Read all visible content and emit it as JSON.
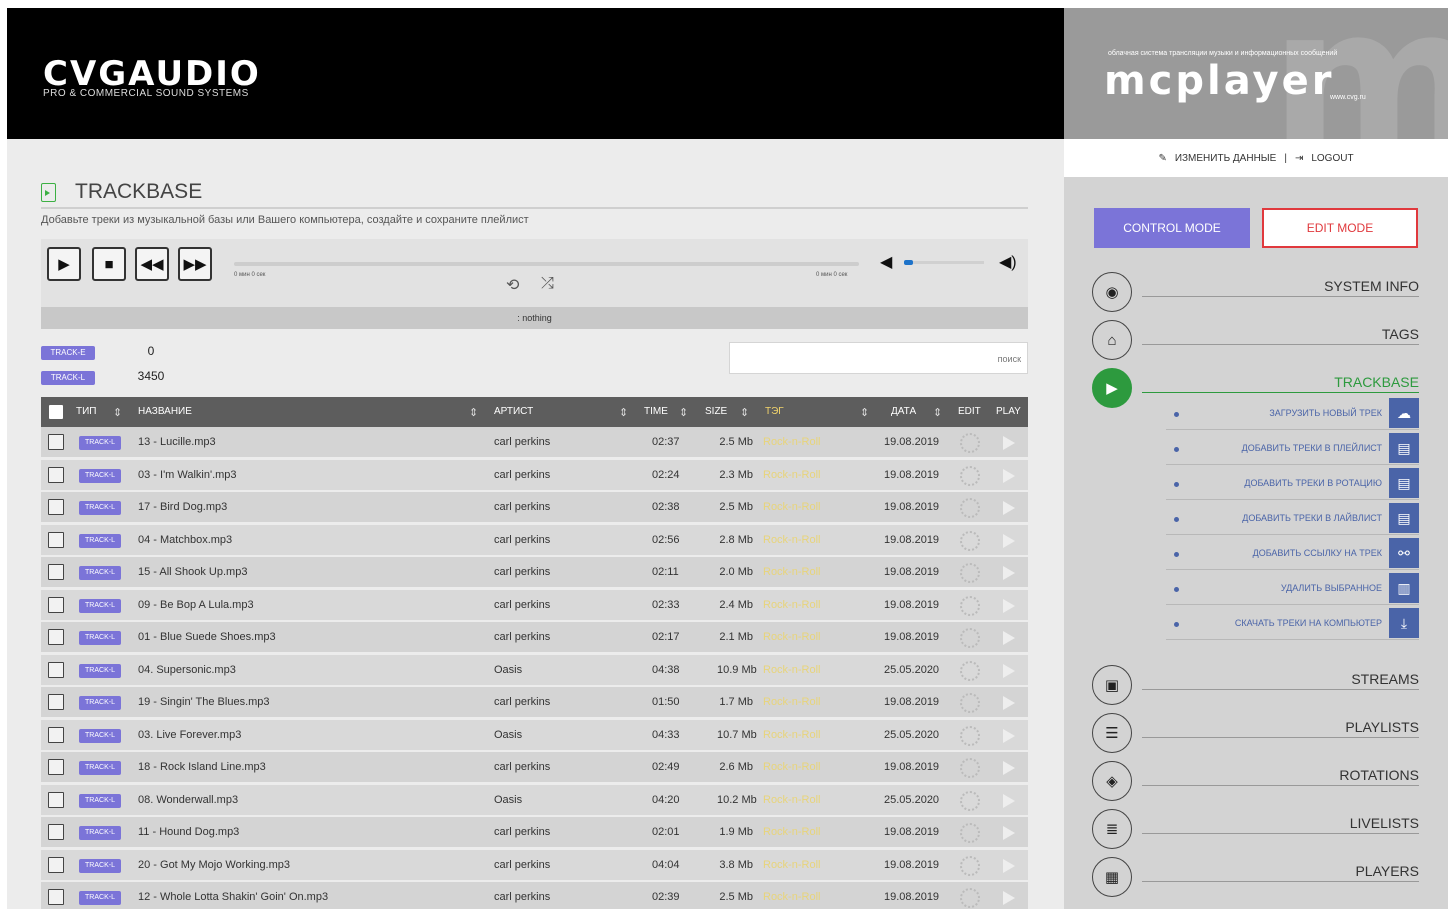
{
  "header": {
    "brand_left": "CVGAUDIO",
    "brand_left_sub": "PRO & COMMERCIAL SOUND SYSTEMS",
    "brand_right": "mcplayer",
    "brand_right_tag": "облачная система трансляции музыки и информационных сообщений",
    "brand_right_url": "www.cvg.ru"
  },
  "page": {
    "title": "TRACKBASE",
    "subtitle": "Добавьте треки из музыкальной базы или Вашего компьютера, создайте и сохраните плейлист"
  },
  "player": {
    "time_start": "0 мин 0 сек",
    "time_end": "0 мин 0 сек",
    "now_playing": ": nothing"
  },
  "counters": [
    {
      "badge": "TRACK-E",
      "count": "0"
    },
    {
      "badge": "TRACK-L",
      "count": "3450"
    }
  ],
  "search": {
    "placeholder": "поиск"
  },
  "table": {
    "headers": {
      "type": "ТИП",
      "name": "НАЗВАНИЕ",
      "artist": "АРТИСТ",
      "time": "TIME",
      "size": "SIZE",
      "tag": "ТЭГ",
      "date": "ДАТА",
      "edit": "EDIT",
      "play": "PLAY"
    },
    "rows": [
      {
        "badge": "TRACK-L",
        "name": "13 - Lucille.mp3",
        "artist": "carl perkins",
        "time": "02:37",
        "size": "2.5 Mb",
        "tag": "Rock-n-Roll",
        "date": "19.08.2019"
      },
      {
        "badge": "TRACK-L",
        "name": "03 - I'm Walkin'.mp3",
        "artist": "carl perkins",
        "time": "02:24",
        "size": "2.3 Mb",
        "tag": "Rock-n-Roll",
        "date": "19.08.2019"
      },
      {
        "badge": "TRACK-L",
        "name": "17 - Bird Dog.mp3",
        "artist": "carl perkins",
        "time": "02:38",
        "size": "2.5 Mb",
        "tag": "Rock-n-Roll",
        "date": "19.08.2019"
      },
      {
        "badge": "TRACK-L",
        "name": "04 - Matchbox.mp3",
        "artist": "carl perkins",
        "time": "02:56",
        "size": "2.8 Mb",
        "tag": "Rock-n-Roll",
        "date": "19.08.2019"
      },
      {
        "badge": "TRACK-L",
        "name": "15 - All Shook Up.mp3",
        "artist": "carl perkins",
        "time": "02:11",
        "size": "2.0 Mb",
        "tag": "Rock-n-Roll",
        "date": "19.08.2019"
      },
      {
        "badge": "TRACK-L",
        "name": "09 - Be Bop A Lula.mp3",
        "artist": "carl perkins",
        "time": "02:33",
        "size": "2.4 Mb",
        "tag": "Rock-n-Roll",
        "date": "19.08.2019"
      },
      {
        "badge": "TRACK-L",
        "name": "01 - Blue Suede Shoes.mp3",
        "artist": "carl perkins",
        "time": "02:17",
        "size": "2.1 Mb",
        "tag": "Rock-n-Roll",
        "date": "19.08.2019"
      },
      {
        "badge": "TRACK-L",
        "name": "04. Supersonic.mp3",
        "artist": "Oasis",
        "time": "04:38",
        "size": "10.9 Mb",
        "tag": "Rock-n-Roll",
        "date": "25.05.2020"
      },
      {
        "badge": "TRACK-L",
        "name": "19 - Singin' The Blues.mp3",
        "artist": "carl perkins",
        "time": "01:50",
        "size": "1.7 Mb",
        "tag": "Rock-n-Roll",
        "date": "19.08.2019"
      },
      {
        "badge": "TRACK-L",
        "name": "03. Live Forever.mp3",
        "artist": "Oasis",
        "time": "04:33",
        "size": "10.7 Mb",
        "tag": "Rock-n-Roll",
        "date": "25.05.2020"
      },
      {
        "badge": "TRACK-L",
        "name": "18 - Rock Island Line.mp3",
        "artist": "carl perkins",
        "time": "02:49",
        "size": "2.6 Mb",
        "tag": "Rock-n-Roll",
        "date": "19.08.2019"
      },
      {
        "badge": "TRACK-L",
        "name": "08. Wonderwall.mp3",
        "artist": "Oasis",
        "time": "04:20",
        "size": "10.2 Mb",
        "tag": "Rock-n-Roll",
        "date": "25.05.2020"
      },
      {
        "badge": "TRACK-L",
        "name": "11 - Hound Dog.mp3",
        "artist": "carl perkins",
        "time": "02:01",
        "size": "1.9 Mb",
        "tag": "Rock-n-Roll",
        "date": "19.08.2019"
      },
      {
        "badge": "TRACK-L",
        "name": "20 - Got My Mojo Working.mp3",
        "artist": "carl perkins",
        "time": "04:04",
        "size": "3.8 Mb",
        "tag": "Rock-n-Roll",
        "date": "19.08.2019"
      },
      {
        "badge": "TRACK-L",
        "name": "12 - Whole Lotta Shakin' Goin' On.mp3",
        "artist": "carl perkins",
        "time": "02:39",
        "size": "2.5 Mb",
        "tag": "Rock-n-Roll",
        "date": "19.08.2019"
      }
    ]
  },
  "sidebar": {
    "edit_profile": "ИЗМЕНИТЬ ДАННЫЕ",
    "separator": "|",
    "logout": "LOGOUT",
    "control_mode": "CONTROL MODE",
    "edit_mode": "EDIT MODE",
    "nav_top": [
      {
        "label": "SYSTEM INFO",
        "icon": "eye-icon"
      },
      {
        "label": "TAGS",
        "icon": "tag-icon"
      },
      {
        "label": "TRACKBASE",
        "icon": "file-icon",
        "active": true
      }
    ],
    "sub_items": [
      {
        "label": "ЗАГРУЗИТЬ НОВЫЙ ТРЕК",
        "icon": "cloud-upload-icon"
      },
      {
        "label": "ДОБАВИТЬ ТРЕКИ В ПЛЕЙЛИСТ",
        "icon": "file-add-icon"
      },
      {
        "label": "ДОБАВИТЬ ТРЕКИ В РОТАЦИЮ",
        "icon": "file-add-icon"
      },
      {
        "label": "ДОБАВИТЬ ТРЕКИ В ЛАЙВЛИСТ",
        "icon": "file-add-icon"
      },
      {
        "label": "ДОБАВИТЬ ССЫЛКУ НА ТРЕК",
        "icon": "link-icon"
      },
      {
        "label": "УДАЛИТЬ ВЫБРАННОЕ",
        "icon": "trash-icon"
      },
      {
        "label": "СКАЧАТЬ ТРЕКИ НА КОМПЬЮТЕР",
        "icon": "download-icon"
      }
    ],
    "nav_bottom": [
      {
        "label": "STREAMS",
        "icon": "stream-icon"
      },
      {
        "label": "PLAYLISTS",
        "icon": "list-icon"
      },
      {
        "label": "ROTATIONS",
        "icon": "layers-icon"
      },
      {
        "label": "LIVELISTS",
        "icon": "livelist-icon"
      },
      {
        "label": "PLAYERS",
        "icon": "player-icon"
      }
    ]
  }
}
